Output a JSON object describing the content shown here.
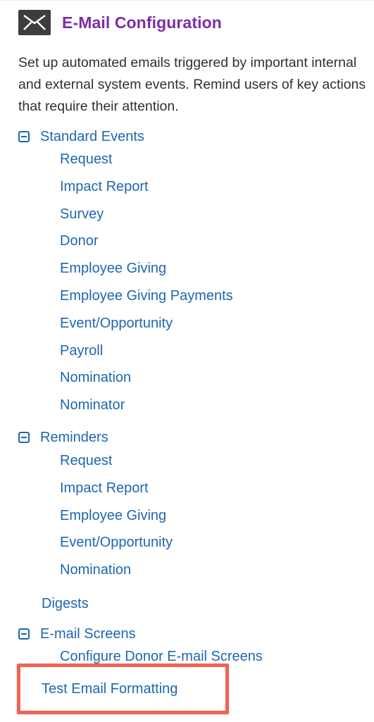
{
  "header": {
    "title": "E-Mail Configuration",
    "icon": "envelope-icon"
  },
  "description": "Set up automated emails triggered by important internal and external system events. Remind users of key actions that require their attention.",
  "groups": {
    "standard_events": {
      "label": "Standard Events",
      "items": [
        "Request",
        "Impact Report",
        "Survey",
        "Donor",
        "Employee Giving",
        "Employee Giving Payments",
        "Event/Opportunity",
        "Payroll",
        "Nomination",
        "Nominator"
      ]
    },
    "reminders": {
      "label": "Reminders",
      "items": [
        "Request",
        "Impact Report",
        "Employee Giving",
        "Event/Opportunity",
        "Nomination"
      ]
    },
    "digests": {
      "label": "Digests"
    },
    "email_screens": {
      "label": "E-mail Screens",
      "items": [
        "Configure Donor E-mail Screens"
      ]
    }
  },
  "test_email": {
    "label": "Test Email Formatting"
  },
  "colors": {
    "link": "#1e67b0",
    "title": "#7c2ca7",
    "highlight": "#f06352"
  }
}
